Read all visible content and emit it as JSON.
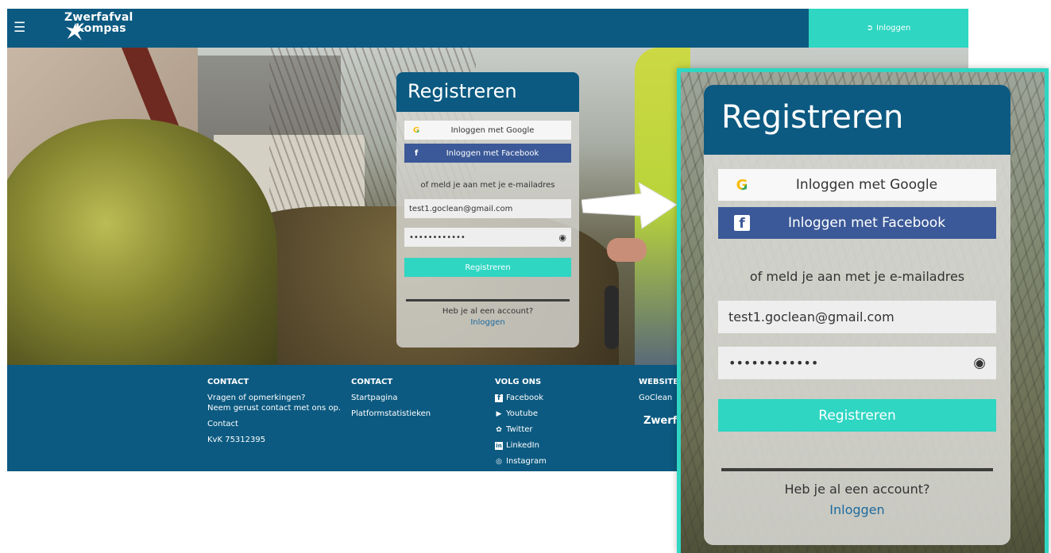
{
  "header": {
    "logo_line1": "Zwerfafval",
    "logo_line2": "Kompas",
    "menu_icon": "hamburger-icon",
    "login_label": "Inloggen",
    "login_icon": "sign-in-icon"
  },
  "card": {
    "title": "Registreren",
    "google_label": "Inloggen met Google",
    "facebook_label": "Inloggen met Facebook",
    "or_text": "of meld je aan met je e-mailadres",
    "email_value": "test1.goclean@gmail.com",
    "password_value": "••••••••••••",
    "register_label": "Registreren",
    "have_account": "Heb je al een account?",
    "login_link": "Inloggen"
  },
  "footer": {
    "col1": {
      "heading": "CONTACT",
      "line1": "Vragen of opmerkingen?",
      "line2": "Neem gerust contact met ons op.",
      "contact": "Contact",
      "kvk": "KvK 75312395"
    },
    "col2": {
      "heading": "CONTACT",
      "link1": "Startpagina",
      "link2": "Platformstatistieken"
    },
    "col3": {
      "heading": "VOLG ONS",
      "facebook": "Facebook",
      "youtube": "Youtube",
      "twitter": "Twitter",
      "linkedin": "LinkedIn",
      "instagram": "Instagram"
    },
    "col4": {
      "heading": "WEBSITE",
      "link1": "GoClean",
      "logo_text": "Zwerf"
    }
  },
  "colors": {
    "brand_blue": "#0c5a81",
    "accent_teal": "#2fd6c2",
    "facebook_blue": "#3b5998"
  }
}
